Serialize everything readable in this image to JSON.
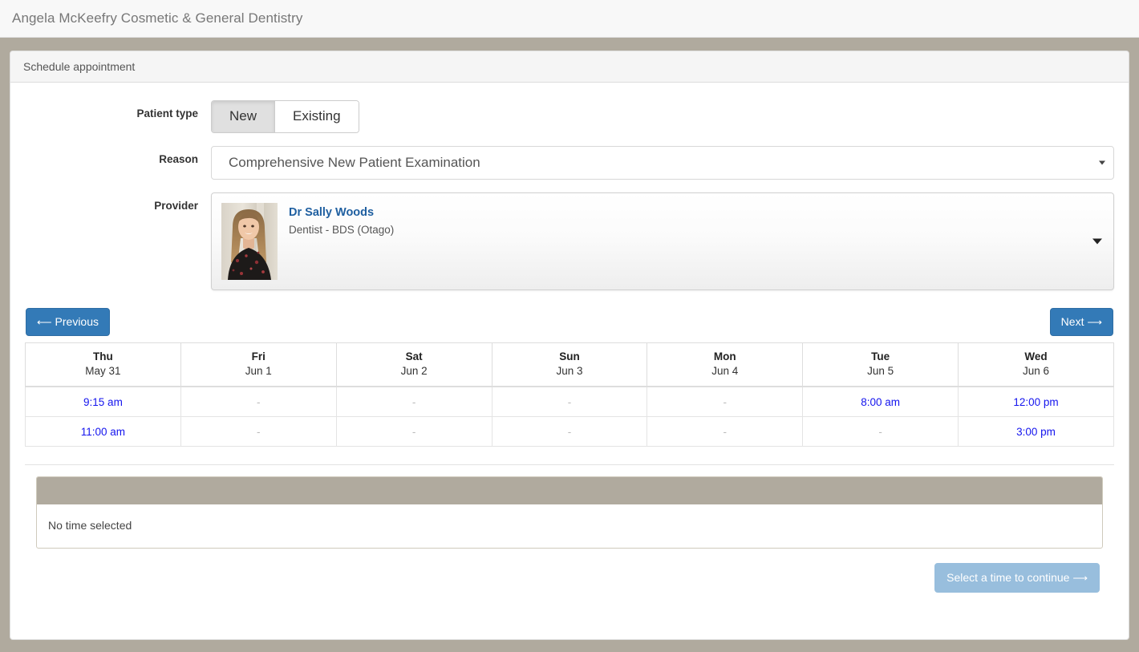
{
  "topbar": {
    "brand": "Angela McKeefry Cosmetic & General Dentistry"
  },
  "card": {
    "header": "Schedule appointment"
  },
  "form": {
    "patient_type": {
      "label": "Patient type",
      "options": [
        "New",
        "Existing"
      ],
      "selected": "New"
    },
    "reason": {
      "label": "Reason",
      "value": "Comprehensive New Patient Examination",
      "caret_icon": "chevron-down-icon"
    },
    "provider": {
      "label": "Provider",
      "name": "Dr Sally Woods",
      "role": "Dentist - BDS (Otago)",
      "photo_icon": "provider-portrait-photo",
      "caret_icon": "chevron-down-icon"
    }
  },
  "nav": {
    "previous_label": "Previous",
    "previous_icon": "arrow-left-icon",
    "next_label": "Next",
    "next_icon": "arrow-right-icon"
  },
  "schedule": {
    "empty_marker": "-",
    "columns": [
      {
        "dow": "Thu",
        "date": "May 31"
      },
      {
        "dow": "Fri",
        "date": "Jun 1"
      },
      {
        "dow": "Sat",
        "date": "Jun 2"
      },
      {
        "dow": "Sun",
        "date": "Jun 3"
      },
      {
        "dow": "Mon",
        "date": "Jun 4"
      },
      {
        "dow": "Tue",
        "date": "Jun 5"
      },
      {
        "dow": "Wed",
        "date": "Jun 6"
      }
    ],
    "rows": [
      [
        "9:15 am",
        "-",
        "-",
        "-",
        "-",
        "8:00 am",
        "12:00 pm"
      ],
      [
        "11:00 am",
        "-",
        "-",
        "-",
        "-",
        "-",
        "3:00 pm"
      ]
    ]
  },
  "selection": {
    "status": "No time selected"
  },
  "footer": {
    "continue_label": "Select a time to continue",
    "continue_icon": "arrow-right-icon",
    "continue_disabled": true
  },
  "colors": {
    "page_background": "#b0aa9e",
    "primary_button": "#337ab7",
    "disabled_button": "#98bedd",
    "link": "#1414ee",
    "provider_name": "#1f5fa0"
  }
}
